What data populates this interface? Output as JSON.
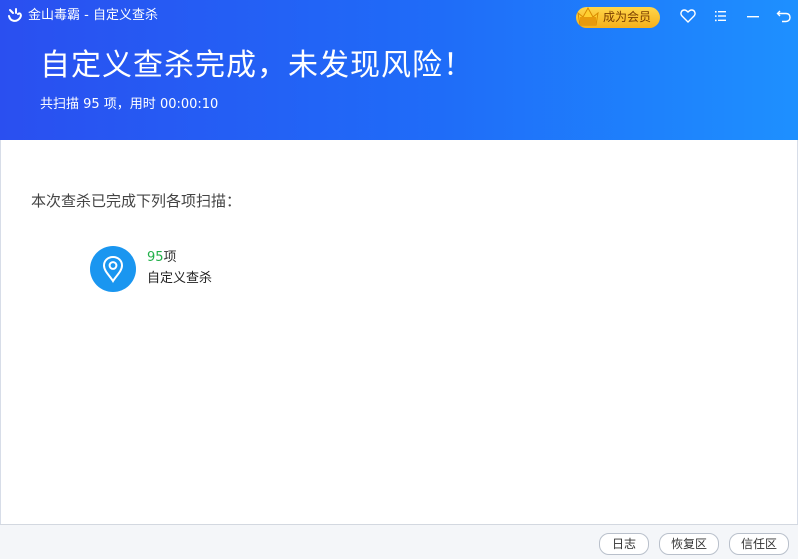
{
  "window": {
    "title": "金山毒霸 - 自定义查杀"
  },
  "vip": {
    "label": "成为会员"
  },
  "header": {
    "headline": "自定义查杀完成，未发现风险！",
    "stats": "共扫描 95 项，用时 00:00:10"
  },
  "content": {
    "section_label": "本次查杀已完成下列各项扫描：",
    "items": [
      {
        "count": "95",
        "unit": "项",
        "name": "自定义查杀",
        "icon": "location-pin-icon"
      }
    ]
  },
  "footer": {
    "log": "日志",
    "restore": "恢复区",
    "trust": "信任区"
  },
  "colors": {
    "header_start": "#2a4ff0",
    "header_end": "#1e90ff",
    "accent_icon": "#1a96f0",
    "count_green": "#22b04a",
    "vip_gold": "#f6b01a"
  }
}
